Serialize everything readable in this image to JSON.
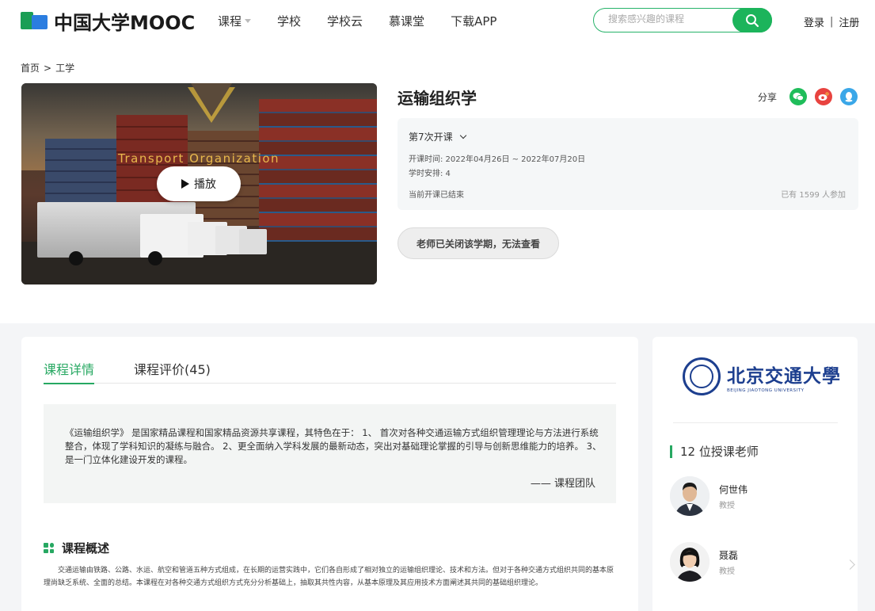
{
  "header": {
    "logo_text": "中国大学MOOC",
    "nav": [
      "课程",
      "学校",
      "学校云",
      "慕课堂",
      "下载APP"
    ],
    "search_placeholder": "搜索感兴趣的课程",
    "login": "登录",
    "register": "注册"
  },
  "breadcrumb": {
    "home": "首页",
    "separator": ">",
    "category": "工学"
  },
  "video": {
    "title": "Transport Organization",
    "play_label": "播放"
  },
  "course": {
    "title": "运输组织学",
    "share_label": "分享",
    "term": "第7次开课",
    "time_line": "开课时间:  2022年04月26日 ~ 2022年07月20日",
    "hours_line": "学时安排:  4",
    "status": "当前开课已结束",
    "enrolled": "已有 1599 人参加",
    "closed_button": "老师已关闭该学期，无法查看"
  },
  "tabs": {
    "detail": "课程详情",
    "reviews": "课程评价(45)"
  },
  "quote": {
    "text": "《运输组织学》 是国家精品课程和国家精品资源共享课程，其特色在于： 1、 首次对各种交通运输方式组织管理理论与方法进行系统整合，体现了学科知识的凝练与融合。 2、更全面纳入学科发展的最新动态，突出对基础理论掌握的引导与创新思维能力的培养。 3、是一门立体化建设开发的课程。",
    "by": "—— 课程团队"
  },
  "overview": {
    "title": "课程概述",
    "text": "交通运输由铁路、公路、水运、航空和管道五种方式组成，在长期的运营实践中，它们各自形成了相对独立的运输组织理论、技术和方法。但对于各种交通方式组织共同的基本原理尚缺乏系统、全面的总结。本课程在对各种交通方式组织方式充分分析基础上，抽取其共性内容，从基本原理及其应用技术方面阐述其共同的基础组织理论。"
  },
  "sidebar": {
    "university": "北京交通大學",
    "university_en": "BEIJING JIAOTONG UNIVERSITY",
    "teachers_heading": "12 位授课老师",
    "teachers": [
      {
        "name": "何世伟",
        "title": "教授"
      },
      {
        "name": "聂磊",
        "title": "教授"
      }
    ]
  },
  "colors": {
    "accent": "#27a862",
    "search_button": "#1cb45b",
    "wechat": "#1fbd5a",
    "weibo": "#e8433f",
    "qq": "#3aa7e8",
    "university_blue": "#1d3f8f"
  }
}
